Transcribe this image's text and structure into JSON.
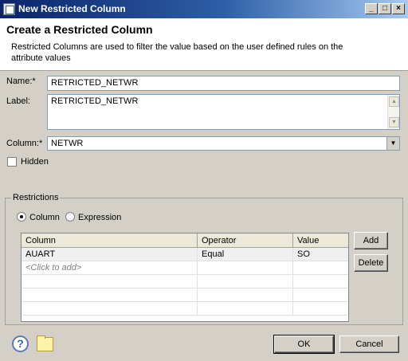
{
  "window": {
    "title": "New Restricted Column"
  },
  "header": {
    "title": "Create a Restricted Column",
    "description": "Restricted Columns are used to filter the value based on the user defined rules on the attribute values"
  },
  "form": {
    "name_label": "Name:*",
    "name_value": "RETRICTED_NETWR",
    "label_label": "Label:",
    "label_value": "RETRICTED_NETWR",
    "column_label": "Column:*",
    "column_value": "NETWR",
    "hidden_label": "Hidden",
    "hidden_checked": false
  },
  "restrictions": {
    "group_title": "Restrictions",
    "radio_column": "Column",
    "radio_expression": "Expression",
    "selected": "Column",
    "columns": [
      "Column",
      "Operator",
      "Value"
    ],
    "rows": [
      {
        "column": "AUART",
        "operator": "Equal",
        "value": "SO"
      }
    ],
    "add_row_placeholder": "<Click to add>",
    "add_button": "Add",
    "delete_button": "Delete"
  },
  "footer": {
    "ok_button": "OK",
    "cancel_button": "Cancel",
    "help_icon_glyph": "?"
  },
  "icons": [
    "window-icon",
    "minimize-icon",
    "maximize-icon",
    "close-icon",
    "help-icon",
    "note-icon",
    "combo-arrow-icon"
  ]
}
